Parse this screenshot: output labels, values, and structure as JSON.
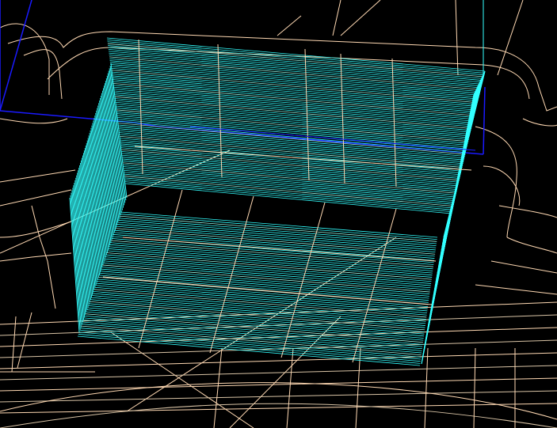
{
  "viewport": {
    "background": "#000000"
  },
  "colors": {
    "toolpath": "#33ffff",
    "toolpath_light": "#99ffee",
    "wireframe": "#ffd9b3",
    "wireframe_dim": "#d9c4a6",
    "boundary": "#1a1aff",
    "feed_line": "#cfe8ff"
  },
  "layers": [
    "part-wireframe",
    "stock-boundary",
    "toolpath-back-wall",
    "toolpath-floor",
    "toolpath-left-wall",
    "toolpath-right-wall",
    "surface-grid"
  ]
}
